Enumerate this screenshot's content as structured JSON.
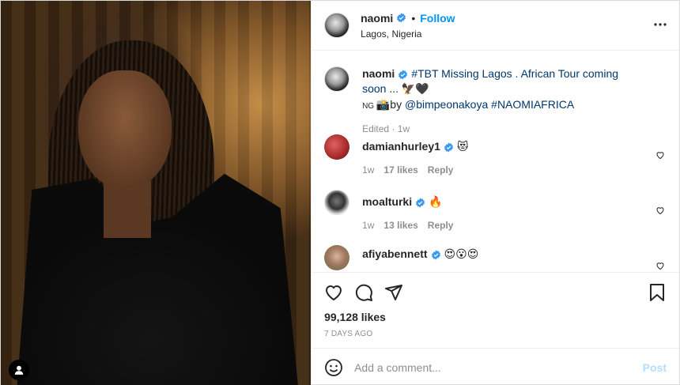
{
  "header": {
    "username": "naomi",
    "dot": "•",
    "follow_label": "Follow",
    "location": "Lagos, Nigeria",
    "more_icon": "more-horizontal-icon"
  },
  "caption": {
    "username": "naomi",
    "text_before": "#TBT Missing Lagos . African Tour coming soon ... ",
    "emojis_a": "🦅🖤",
    "text_ng": "NG ",
    "camera": "📸",
    "by": "by ",
    "mention": "@bimpeonakoya",
    "hashtag": "#NAOMIAFRICA",
    "edited": "Edited · 1w"
  },
  "comments": [
    {
      "username": "damianhurley1",
      "text": "😻",
      "time": "1w",
      "likes": "17 likes",
      "reply": "Reply",
      "avatar_color": "#b03a3a"
    },
    {
      "username": "moalturki",
      "text": "🔥",
      "time": "1w",
      "likes": "13 likes",
      "reply": "Reply",
      "avatar_color": "#d9d9d9"
    },
    {
      "username": "afiyabennett",
      "text": "😍😮😍",
      "avatar_color": "#c9a38a"
    }
  ],
  "actions": {
    "like_icon": "heart-outline-icon",
    "comment_icon": "comment-bubble-icon",
    "share_icon": "paper-plane-icon",
    "save_icon": "bookmark-icon",
    "likes": "99,128 likes",
    "time": "7 DAYS AGO"
  },
  "add_comment": {
    "placeholder": "Add a comment...",
    "post_label": "Post"
  },
  "colors": {
    "accent": "#0095f6",
    "verified": "#3897f0",
    "link": "#00376b",
    "post_disabled": "#b2dffc"
  }
}
